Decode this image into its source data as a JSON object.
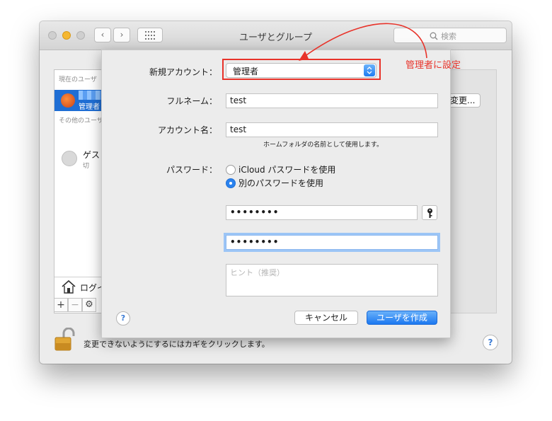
{
  "window": {
    "title": "ユーザとグループ",
    "search_placeholder": "検索",
    "nav_back": "‹",
    "nav_forward": "›"
  },
  "sidebar": {
    "current_user_section": "現在のユーザ",
    "current_user_role": "管理者",
    "other_users_section": "その他のユーザ",
    "guest_name": "ゲスト",
    "guest_status": "切",
    "login_options": "ログインオプション",
    "add_label": "+",
    "remove_label": "−",
    "gear_label": "⚙"
  },
  "main": {
    "change_button": "変更..."
  },
  "footer": {
    "lock_text": "変更できないようにするにはカギをクリックします。",
    "help_label": "?"
  },
  "sheet": {
    "new_account_label": "新規アカウント：",
    "new_account_value": "管理者",
    "full_name_label": "フルネーム：",
    "full_name_value": "test",
    "account_name_label": "アカウント名：",
    "account_name_value": "test",
    "home_folder_hint": "ホームフォルダの名前として使用します。",
    "password_label": "パスワード：",
    "radio_icloud": "iCloud パスワードを使用",
    "radio_separate": "別のパスワードを使用",
    "selected_radio": "radio_separate",
    "password_value": "••••••••",
    "verify_value": "••••••••",
    "hint_placeholder": "ヒント（推奨）",
    "help_label": "?",
    "cancel_button": "キャンセル",
    "create_button": "ユーザを作成"
  },
  "annotation": {
    "text": "管理者に設定",
    "color": "#e8332a"
  },
  "colors": {
    "accent": "#1f6ed4",
    "primary_button": "#1c78f0"
  }
}
